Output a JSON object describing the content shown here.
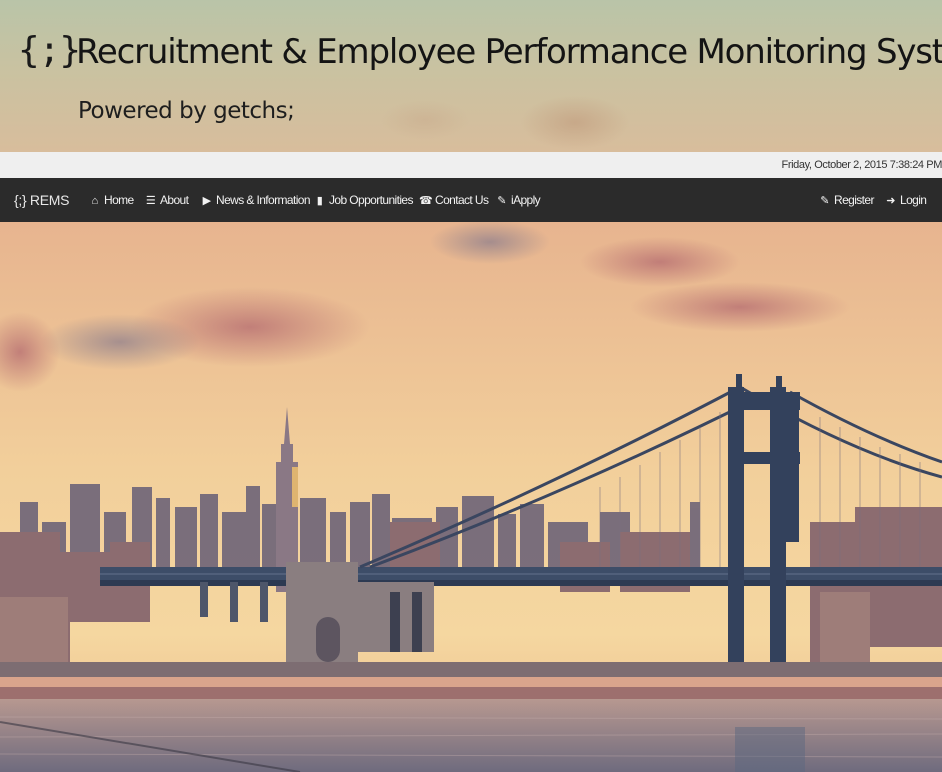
{
  "header": {
    "logo": "{;}",
    "title": "Recruitment & Employee Performance Monitoring System",
    "subtitle": "Powered by getchs;"
  },
  "datetime": "Friday, October 2, 2015 7:38:24 PM",
  "navbar": {
    "brand": "{;} REMS",
    "items": [
      {
        "label": "Home",
        "icon": "home-icon"
      },
      {
        "label": "About",
        "icon": "list-icon"
      },
      {
        "label": "News & Information",
        "icon": "megaphone-icon"
      },
      {
        "label": "Job Opportunities",
        "icon": "briefcase-icon"
      },
      {
        "label": "Contact Us",
        "icon": "phone-icon"
      },
      {
        "label": "iApply",
        "icon": "pencil-icon"
      }
    ],
    "right_items": [
      {
        "label": "Register",
        "icon": "edit-icon"
      },
      {
        "label": "Login",
        "icon": "login-icon"
      }
    ]
  },
  "colors": {
    "navbar_bg": "#2b2b2b",
    "datebar_bg": "#efefef",
    "sky_top": "#e6b58e",
    "sky_glow": "#f3d29b"
  }
}
